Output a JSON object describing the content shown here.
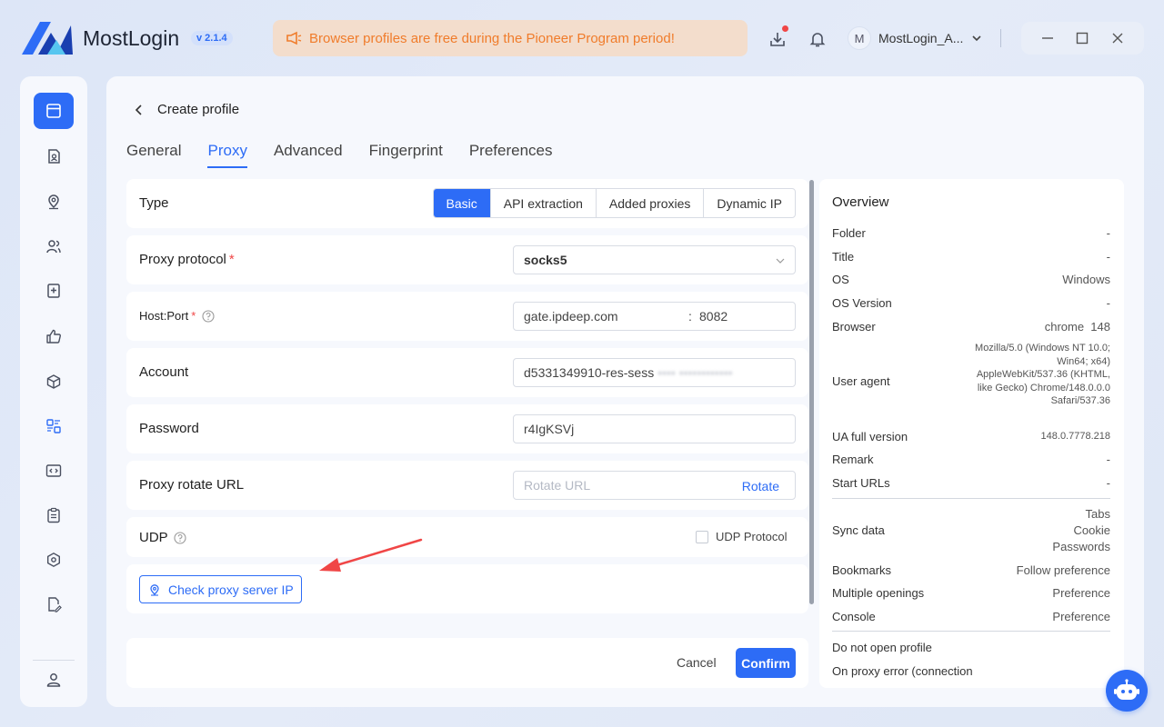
{
  "app": {
    "name": "MostLogin",
    "version": "v 2.1.4"
  },
  "banner": {
    "text": "Browser profiles are free during the Pioneer Program period!"
  },
  "user": {
    "avatar_letter": "M",
    "name": "MostLogin_A..."
  },
  "colors": {
    "accent": "#2d6cf6",
    "banner_text": "#f07c2b",
    "required": "#f04646"
  },
  "sidebar": {
    "items": [
      {
        "icon": "browser-window-icon",
        "active": true
      },
      {
        "icon": "profile-doc-icon"
      },
      {
        "icon": "location-pin-icon"
      },
      {
        "icon": "users-icon"
      },
      {
        "icon": "bookmark-add-icon"
      },
      {
        "icon": "thumbs-up-icon"
      },
      {
        "icon": "cube-icon"
      },
      {
        "icon": "layout-grid-icon"
      },
      {
        "icon": "code-window-icon"
      },
      {
        "icon": "clipboard-icon"
      },
      {
        "icon": "settings-hex-icon"
      },
      {
        "icon": "document-edit-icon"
      }
    ],
    "bottom_icon": "user-account-icon"
  },
  "page": {
    "back_title": "Create profile",
    "tabs": [
      "General",
      "Proxy",
      "Advanced",
      "Fingerprint",
      "Preferences"
    ],
    "active_tab": "Proxy"
  },
  "form": {
    "type": {
      "label": "Type",
      "options": [
        "Basic",
        "API extraction",
        "Added proxies",
        "Dynamic IP"
      ],
      "selected": "Basic"
    },
    "protocol": {
      "label": "Proxy protocol",
      "required": "*",
      "value": "socks5"
    },
    "hostport": {
      "label": "Host:Port",
      "required": "*",
      "host": "gate.ipdeep.com",
      "separator": ":",
      "port": "8082"
    },
    "account": {
      "label": "Account",
      "value": "d5331349910-res-sess",
      "hidden_value": "•••• ••••••••••••"
    },
    "password": {
      "label": "Password",
      "value": "r4IgKSVj"
    },
    "rotate": {
      "label": "Proxy rotate URL",
      "placeholder": "Rotate URL",
      "button": "Rotate"
    },
    "udp": {
      "label": "UDP",
      "checkbox_label": "UDP Protocol",
      "checked": false
    },
    "check_button": "Check proxy server IP"
  },
  "footer": {
    "cancel": "Cancel",
    "confirm": "Confirm"
  },
  "overview": {
    "title": "Overview",
    "rows": [
      {
        "key": "Folder",
        "value": "-"
      },
      {
        "key": "Title",
        "value": "-"
      },
      {
        "key": "OS",
        "value": "Windows"
      },
      {
        "key": "OS Version",
        "value": "-"
      },
      {
        "key": "Browser",
        "value": "chrome  148"
      }
    ],
    "user_agent": {
      "key": "User agent",
      "value": "Mozilla/5.0 (Windows NT 10.0; Win64; x64) AppleWebKit/537.36 (KHTML, like Gecko) Chrome/148.0.0.0 Safari/537.36"
    },
    "rows2": [
      {
        "key": "UA full version",
        "value": "148.0.7778.218"
      },
      {
        "key": "Remark",
        "value": "-"
      },
      {
        "key": "Start URLs",
        "value": "-"
      }
    ],
    "sync": {
      "key": "Sync data",
      "values": [
        "Tabs",
        "Cookie",
        "Passwords"
      ]
    },
    "rows3": [
      {
        "key": "Bookmarks",
        "value": "Follow preference"
      },
      {
        "key": "Multiple openings",
        "value": "Preference"
      },
      {
        "key": "Console",
        "value": "Preference"
      }
    ],
    "rows4": [
      {
        "key": "Do not open profile",
        "value": ""
      },
      {
        "key": "On proxy error (connection",
        "value": ""
      }
    ]
  }
}
